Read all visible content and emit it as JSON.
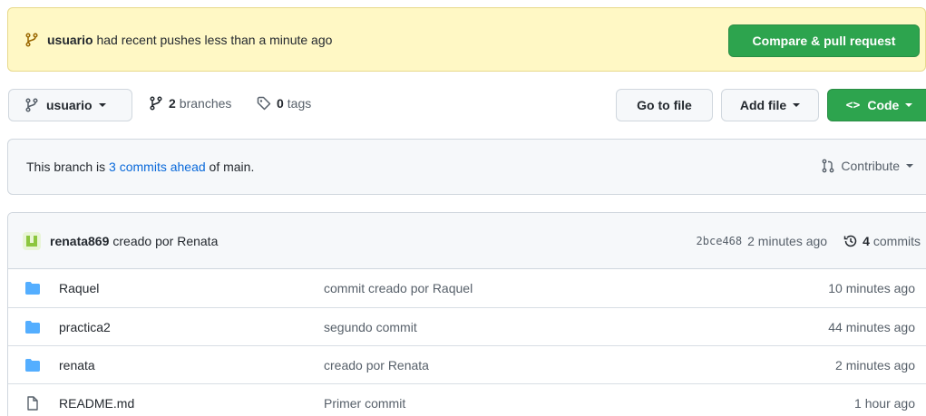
{
  "flash": {
    "user": "usuario",
    "message": " had recent pushes less than a minute ago",
    "button": "Compare & pull request"
  },
  "toolbar": {
    "branch": "usuario",
    "branches_count": "2",
    "branches_label": "branches",
    "tags_count": "0",
    "tags_label": "tags",
    "goto_file": "Go to file",
    "add_file": "Add file",
    "code": "Code"
  },
  "ahead": {
    "prefix": "This branch is ",
    "link": "3 commits ahead",
    "suffix": " of main.",
    "contribute": "Contribute"
  },
  "latest_commit": {
    "author": "renata869",
    "message": "creado por Renata",
    "sha": "2bce468",
    "time": "2 minutes ago",
    "commits_count": "4",
    "commits_label": "commits"
  },
  "files": [
    {
      "name": "Raquel",
      "type": "folder",
      "message": "commit creado por Raquel",
      "age": "10 minutes ago"
    },
    {
      "name": "practica2",
      "type": "folder",
      "message": "segundo commit",
      "age": "44 minutes ago"
    },
    {
      "name": "renata",
      "type": "folder",
      "message": "creado por Renata",
      "age": "2 minutes ago"
    },
    {
      "name": "README.md",
      "type": "file",
      "message": "Primer commit",
      "age": "1 hour ago"
    }
  ],
  "colors": {
    "accent_green": "#2da44e",
    "link_blue": "#0969da",
    "folder_blue": "#54aeff",
    "flash_bg": "#fff8c5"
  }
}
